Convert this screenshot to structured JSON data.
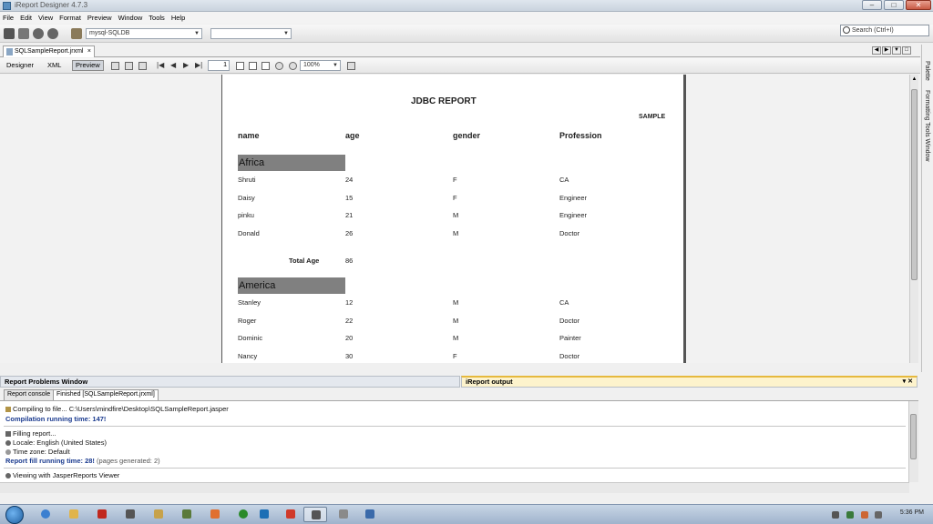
{
  "window": {
    "title": "iReport Designer 4.7.3"
  },
  "menu": [
    "File",
    "Edit",
    "View",
    "Format",
    "Preview",
    "Window",
    "Tools",
    "Help"
  ],
  "toolbar": {
    "datasource_select": "mysql-SQLDB",
    "second_select": ""
  },
  "search": {
    "placeholder": "Search (Ctrl+I)"
  },
  "document_tab": {
    "label": "SQLSampleReport.jrxml"
  },
  "designer_modes": [
    "Designer",
    "XML",
    "Preview"
  ],
  "active_mode": "Preview",
  "page_number": "1",
  "zoom": "100%",
  "report": {
    "title": "JDBC REPORT",
    "sample_label": "SAMPLE",
    "columns": [
      "name",
      "age",
      "gender",
      "Profession"
    ],
    "groups": [
      {
        "name": "Africa",
        "rows": [
          [
            "Shruti",
            "24",
            "F",
            "CA"
          ],
          [
            "Daisy",
            "15",
            "F",
            "Engineer"
          ],
          [
            "pinku",
            "21",
            "M",
            "Engineer"
          ],
          [
            "Donald",
            "26",
            "M",
            "Doctor"
          ]
        ],
        "total_label": "Total Age",
        "total_value": "86"
      },
      {
        "name": "America",
        "rows": [
          [
            "Stanley",
            "12",
            "M",
            "CA"
          ],
          [
            "Roger",
            "22",
            "M",
            "Doctor"
          ],
          [
            "Dominic",
            "20",
            "M",
            "Painter"
          ],
          [
            "Nancy",
            "30",
            "F",
            "Doctor"
          ]
        ]
      }
    ]
  },
  "side_panel": {
    "palette": "Palette",
    "formatting": "Formatting Tools Window"
  },
  "bottom": {
    "problems_title": "Report Problems Window",
    "output_title": "iReport output",
    "subtabs": [
      "Report console",
      "Finished [SQLSampleReport.jrxml]"
    ],
    "console": {
      "compiling": "Compiling to file... C:\\Users\\mindfire\\Desktop\\SQLSampleReport.jasper",
      "compilation_time": "Compilation running time: 147!",
      "filling": "Filling report...",
      "locale": "Locale: English (United States)",
      "timezone": "Time zone: Default",
      "fill_time": "Report fill running time: 28!",
      "pages_generated": "(pages generated: 2)",
      "viewing": "Viewing with JasperReports Viewer"
    }
  },
  "taskbar": {
    "clock": "5:36 PM"
  }
}
